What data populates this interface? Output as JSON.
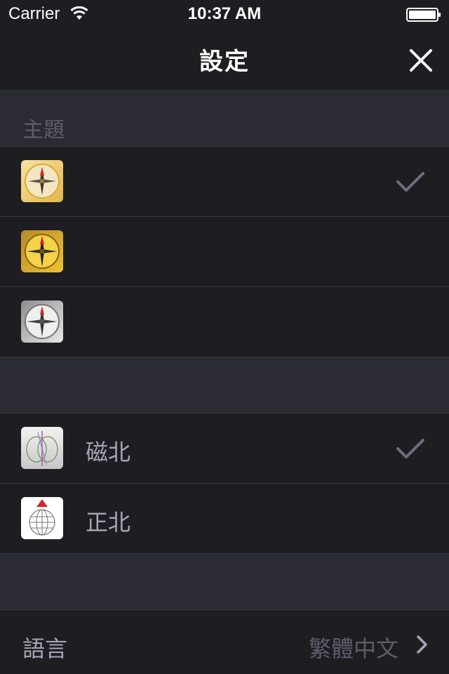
{
  "status_bar": {
    "carrier": "Carrier",
    "time": "10:37 AM",
    "wifi_icon": "wifi-icon",
    "battery_icon": "battery-icon"
  },
  "nav": {
    "title": "設定",
    "close_icon": "close-icon"
  },
  "theme_section": {
    "header": "主題",
    "items": [
      {
        "icon": "compass-gold-light-icon",
        "label": "",
        "selected": true
      },
      {
        "icon": "compass-gold-dark-icon",
        "label": "",
        "selected": false
      },
      {
        "icon": "compass-silver-icon",
        "label": "",
        "selected": false
      }
    ]
  },
  "north_section": {
    "header": "",
    "items": [
      {
        "icon": "magnetic-field-icon",
        "label": "磁北",
        "selected": true
      },
      {
        "icon": "globe-north-icon",
        "label": "正北",
        "selected": false
      }
    ]
  },
  "language": {
    "label": "語言",
    "value": "繁體中文",
    "chevron_icon": "chevron-right-icon"
  },
  "colors": {
    "background": "#1e1d22",
    "section_header": "#2b2b33",
    "label": "#a7a6b6",
    "secondary": "#5e5d6a",
    "check": "#6f6e7c"
  }
}
